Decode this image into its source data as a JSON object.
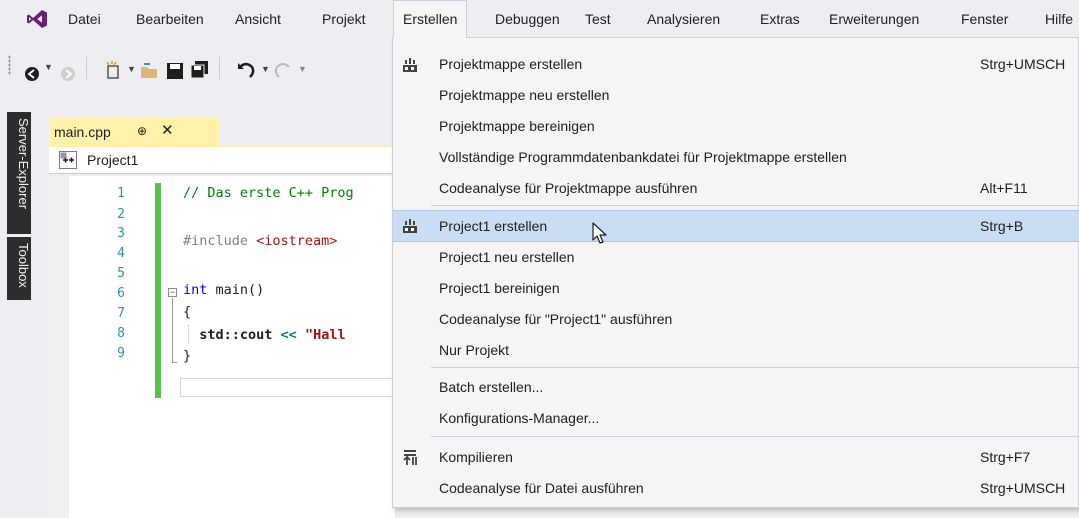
{
  "menubar": {
    "items": [
      "Datei",
      "Bearbeiten",
      "Ansicht",
      "Projekt",
      "Erstellen",
      "Debuggen",
      "Test",
      "Analysieren",
      "Extras",
      "Erweiterungen",
      "Fenster",
      "Hilfe"
    ],
    "open_item": "Erstellen"
  },
  "sidebar": {
    "server_explorer": "Server-Explorer",
    "toolbox": "Toolbox"
  },
  "document_tab": {
    "filename": "main.cpp",
    "pin": "⊕",
    "close": "✕"
  },
  "navbar": {
    "project": "Project1"
  },
  "editor": {
    "line_numbers": [
      "1",
      "2",
      "3",
      "4",
      "5",
      "6",
      "7",
      "8",
      "9"
    ],
    "lines": {
      "l1_comment": "// Das erste C++ Prog",
      "l3_pre": "#include ",
      "l3_header": "<iostream>",
      "l5_kw": "int",
      "l5_rest": " main()",
      "l6": "{",
      "l7_a": "  std::cout ",
      "l7_op": "<<",
      "l7_str": " \"Hall",
      "l8": "}"
    }
  },
  "dropdown": {
    "items": [
      {
        "label": "Projektmappe erstellen",
        "shortcut": "Strg+UMSCH",
        "icon": "build-solution-icon"
      },
      {
        "label": "Projektmappe neu erstellen",
        "shortcut": ""
      },
      {
        "label": "Projektmappe bereinigen",
        "shortcut": ""
      },
      {
        "label": "Vollständige Programmdatenbankdatei für Projektmappe erstellen",
        "shortcut": ""
      },
      {
        "label": "Codeanalyse für Projektmappe ausführen",
        "shortcut": "Alt+F11"
      },
      {
        "label": "Project1 erstellen",
        "shortcut": "Strg+B",
        "icon": "build-project-icon"
      },
      {
        "label": "Project1 neu erstellen",
        "shortcut": ""
      },
      {
        "label": "Project1 bereinigen",
        "shortcut": ""
      },
      {
        "label": "Codeanalyse für \"Project1\" ausführen",
        "shortcut": ""
      },
      {
        "label": "Nur Projekt",
        "shortcut": ""
      },
      {
        "label": "Batch erstellen...",
        "shortcut": ""
      },
      {
        "label": "Konfigurations-Manager...",
        "shortcut": ""
      },
      {
        "label": "Kompilieren",
        "shortcut": "Strg+F7",
        "icon": "compile-icon"
      },
      {
        "label": "Codeanalyse für Datei ausführen",
        "shortcut": "Strg+UMSCH"
      }
    ],
    "highlighted_index": 5
  },
  "colors": {
    "accent_vs": "#68217a",
    "highlight": "#c9def5",
    "change_bar": "#57c34a",
    "tab_active": "#fff1a8"
  }
}
